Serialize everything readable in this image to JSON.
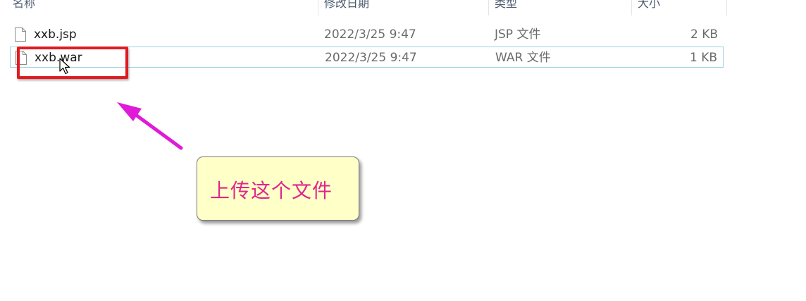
{
  "columns": {
    "name": "名称",
    "date": "修改日期",
    "type": "类型",
    "size": "大小"
  },
  "files": [
    {
      "name": "xxb.jsp",
      "date": "2022/3/25 9:47",
      "type": "JSP 文件",
      "size": "2 KB",
      "icon": "file-icon"
    },
    {
      "name": "xxb.war",
      "date": "2022/3/25 9:47",
      "type": "WAR 文件",
      "size": "1 KB",
      "icon": "file-icon",
      "selected": true
    }
  ],
  "annotation": {
    "text": "上传这个文件",
    "highlight_color": "#e01b22",
    "arrow_color": "#e01bd7",
    "note_background": "#ffffc8",
    "note_text_color": "#e0258d"
  }
}
